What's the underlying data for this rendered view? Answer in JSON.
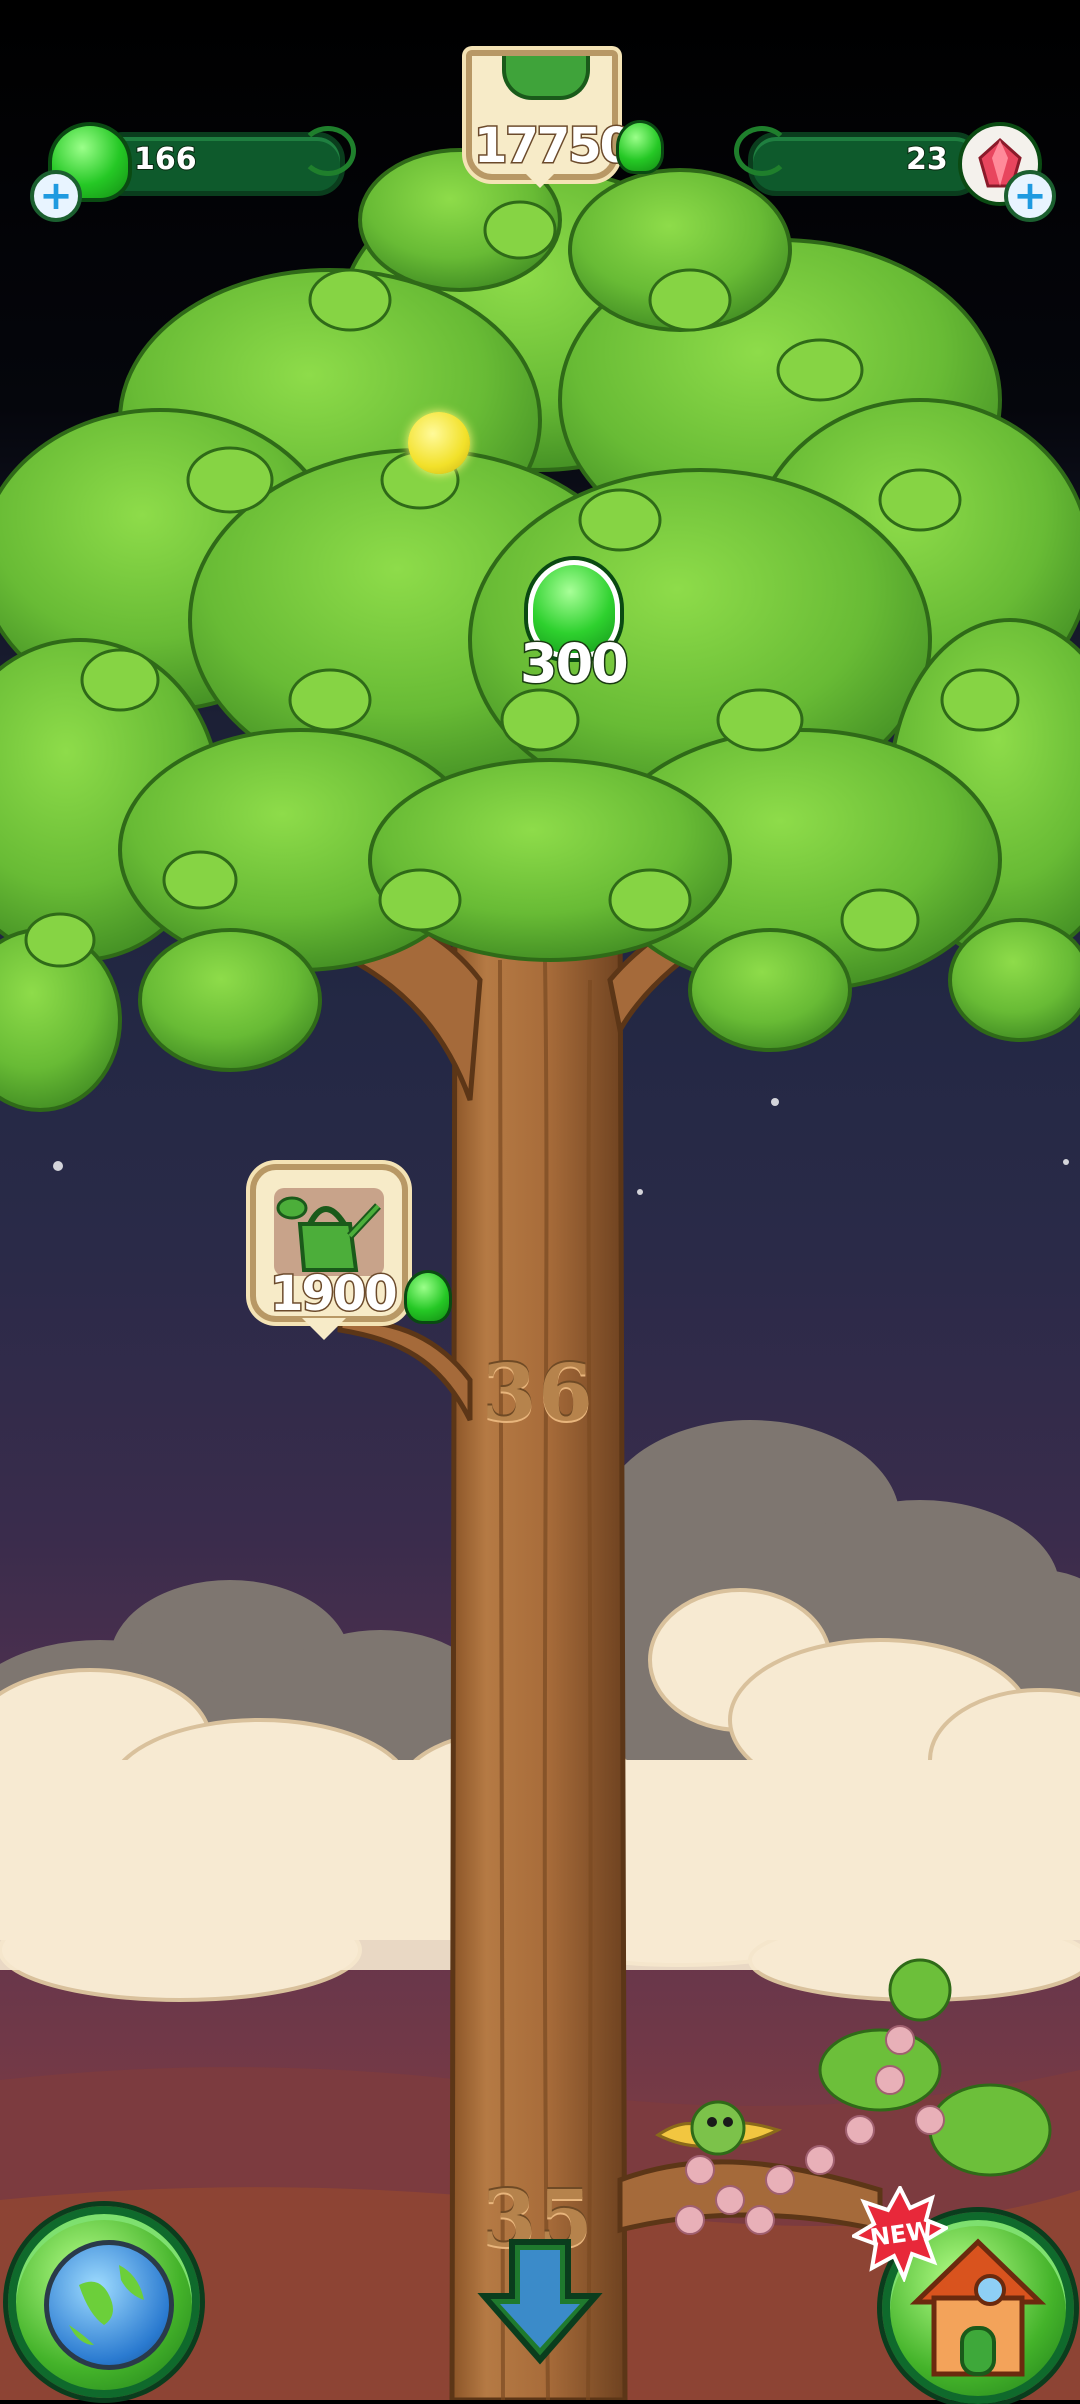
{
  "hud": {
    "jelly_count": "166",
    "gem_count": "23",
    "next_level_cost": "17750"
  },
  "tree": {
    "jelly_pickup_value": "300",
    "watering_can_cost": "1900",
    "level_upper": "36",
    "level_lower": "35"
  },
  "nav": {
    "new_badge": "NEW"
  },
  "icons": {
    "jelly": "green-jelly-icon",
    "gem": "red-gem-icon",
    "watering_can": "watering-can-icon",
    "globe": "globe-icon",
    "house": "house-icon",
    "down_arrow": "down-arrow-icon"
  },
  "colors": {
    "hud_bar": "#0e5a2c",
    "jelly_green": "#2ed12e",
    "leaf_green": "#6cbf3a",
    "trunk": "#a56a3a",
    "night_sky": "#222845",
    "sunset": "#7a3a45"
  }
}
